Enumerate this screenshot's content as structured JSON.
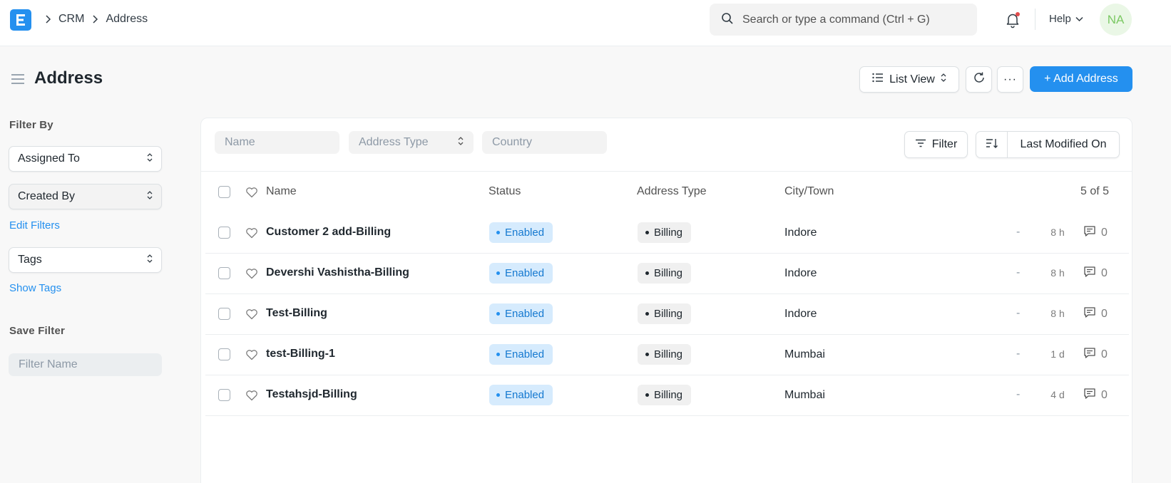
{
  "navbar": {
    "breadcrumbs": [
      "CRM",
      "Address"
    ],
    "search_placeholder": "Search or type a command (Ctrl + G)",
    "help_label": "Help",
    "avatar_initials": "NA"
  },
  "page": {
    "title": "Address",
    "list_view_label": "List View",
    "more_label": "···",
    "add_button_label": "+ Add Address"
  },
  "sidebar": {
    "filter_by_heading": "Filter By",
    "assigned_to_label": "Assigned To",
    "created_by_label": "Created By",
    "edit_filters_label": "Edit Filters",
    "tags_label": "Tags",
    "show_tags_label": "Show Tags",
    "save_filter_heading": "Save Filter",
    "filter_name_placeholder": "Filter Name"
  },
  "filters": {
    "name_placeholder": "Name",
    "address_type_placeholder": "Address Type",
    "country_placeholder": "Country",
    "filter_button_label": "Filter",
    "sort_label": "Last Modified On"
  },
  "table": {
    "columns": {
      "name": "Name",
      "status": "Status",
      "address_type": "Address Type",
      "city": "City/Town"
    },
    "count_label": "5 of 5",
    "rows": [
      {
        "name": "Customer 2 add-Billing",
        "status": "Enabled",
        "address_type": "Billing",
        "city": "Indore",
        "dash": "-",
        "modified": "8 h",
        "comments": "0"
      },
      {
        "name": "Devershi Vashistha-Billing",
        "status": "Enabled",
        "address_type": "Billing",
        "city": "Indore",
        "dash": "-",
        "modified": "8 h",
        "comments": "0"
      },
      {
        "name": "Test-Billing",
        "status": "Enabled",
        "address_type": "Billing",
        "city": "Indore",
        "dash": "-",
        "modified": "8 h",
        "comments": "0"
      },
      {
        "name": "test-Billing-1",
        "status": "Enabled",
        "address_type": "Billing",
        "city": "Mumbai",
        "dash": "-",
        "modified": "1 d",
        "comments": "0"
      },
      {
        "name": "Testahsjd-Billing",
        "status": "Enabled",
        "address_type": "Billing",
        "city": "Mumbai",
        "dash": "-",
        "modified": "4 d",
        "comments": "0"
      }
    ]
  },
  "colors": {
    "primary": "#2490ef",
    "enabled_bg": "#d6ebfd",
    "enabled_text": "#1579d0",
    "notification_dot": "#e24c4c",
    "avatar_bg": "#eaf7e6",
    "avatar_text": "#7cc964"
  },
  "icons": [
    "app-logo-icon",
    "chevron-right-icon",
    "search-icon",
    "bell-icon",
    "chevron-down-icon",
    "menu-icon",
    "list-icon",
    "sort-arrows-icon",
    "refresh-icon",
    "filter-icon",
    "sort-direction-icon",
    "heart-icon",
    "comment-icon"
  ]
}
